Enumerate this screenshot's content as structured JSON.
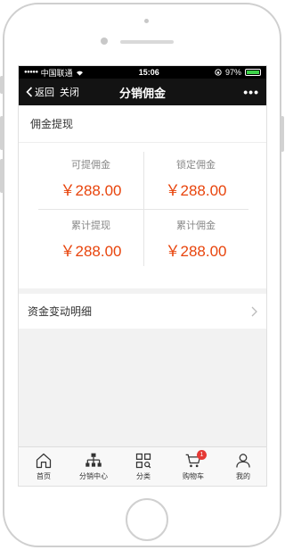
{
  "status_bar": {
    "carrier": "中国联通",
    "time": "15:06",
    "battery_percent": "97%",
    "battery_level": 0.97
  },
  "nav": {
    "back_label": "返回",
    "close_label": "关闭",
    "title": "分销佣金",
    "more_label": "•••"
  },
  "commission": {
    "section_title": "佣金提现",
    "cells": [
      {
        "label": "可提佣金",
        "value": "￥288.00"
      },
      {
        "label": "锁定佣金",
        "value": "￥288.00"
      },
      {
        "label": "累计提现",
        "value": "￥288.00"
      },
      {
        "label": "累计佣金",
        "value": "￥288.00"
      }
    ]
  },
  "details": {
    "label": "资金变动明细"
  },
  "tabbar": {
    "items": [
      {
        "label": "首页",
        "icon": "home-icon"
      },
      {
        "label": "分销中心",
        "icon": "org-chart-icon"
      },
      {
        "label": "分类",
        "icon": "category-grid-icon"
      },
      {
        "label": "购物车",
        "icon": "cart-icon",
        "badge": "1"
      },
      {
        "label": "我的",
        "icon": "user-icon"
      }
    ]
  },
  "colors": {
    "accent": "#e8440c",
    "nav_bg": "#131313",
    "badge": "#e53935"
  }
}
